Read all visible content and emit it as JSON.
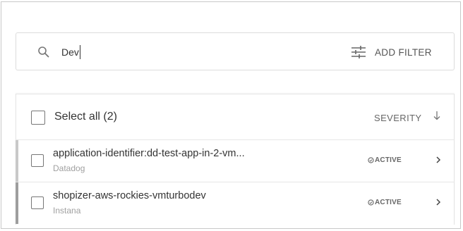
{
  "search": {
    "value": "Dev",
    "icon": "search-icon"
  },
  "filter": {
    "label": "ADD FILTER",
    "icon": "sliders-icon"
  },
  "list": {
    "select_all_label": "Select all (2)",
    "sort_label": "SEVERITY",
    "sort_icon": "arrow-down-icon",
    "rows": [
      {
        "title": "application-identifier:dd-test-app-in-2-vm...",
        "source": "Datadog",
        "status": "ACTIVE",
        "status_icon": "check-circle-icon",
        "marker_color": "#c9c9c9"
      },
      {
        "title": "shopizer-aws-rockies-vmturbodev",
        "source": "Instana",
        "status": "ACTIVE",
        "status_icon": "check-circle-icon",
        "marker_color": "#9e9e9e"
      }
    ]
  }
}
